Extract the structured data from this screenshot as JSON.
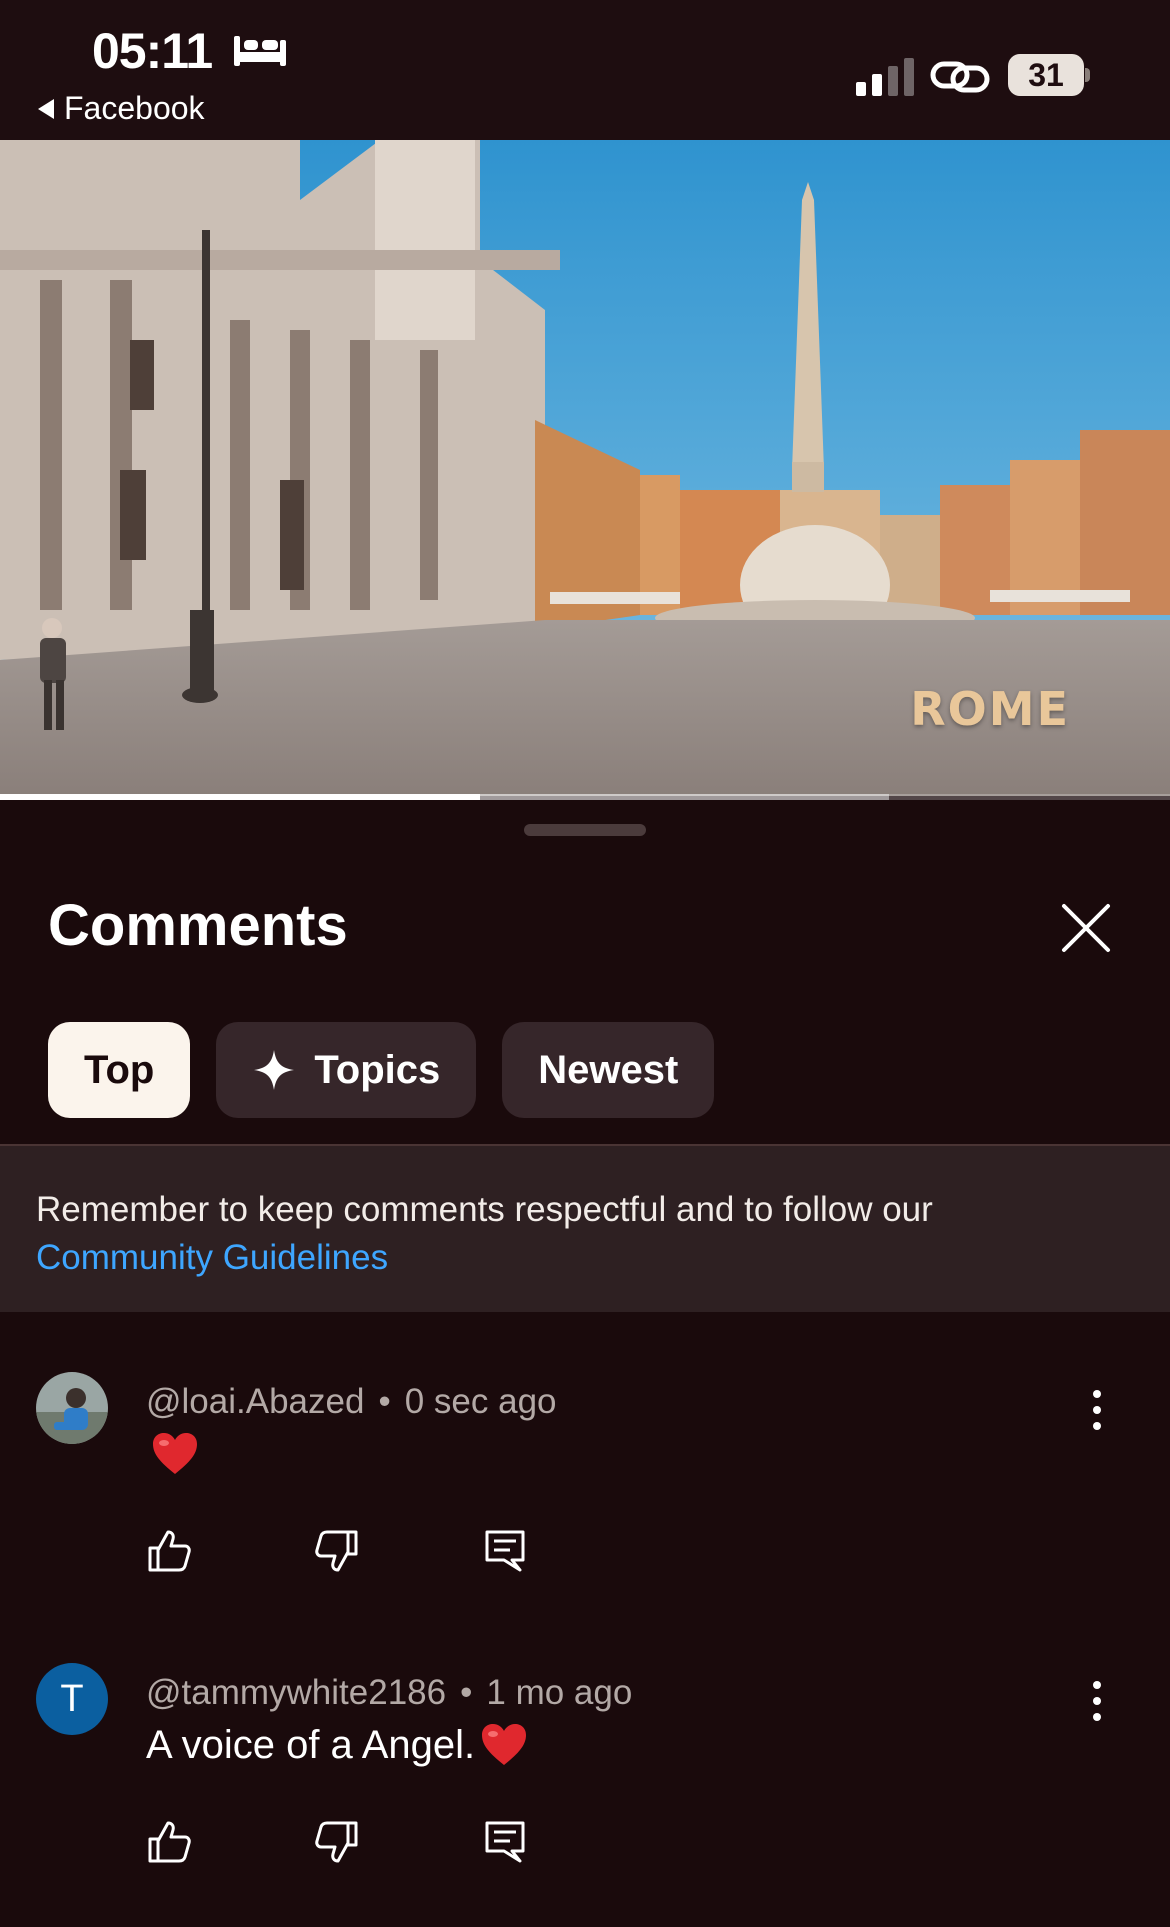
{
  "status_bar": {
    "time": "05:11",
    "back_app": "Facebook",
    "battery": "31"
  },
  "video": {
    "caption": "ROME",
    "progress": 0.41,
    "buffered": 0.76
  },
  "comments_sheet": {
    "title": "Comments",
    "tabs": [
      {
        "label": "Top",
        "active": true
      },
      {
        "label": "Topics",
        "active": false,
        "icon": "sparkle-icon"
      },
      {
        "label": "Newest",
        "active": false
      }
    ],
    "notice": {
      "text": "Remember to keep comments respectful and to follow our",
      "link": "Community Guidelines"
    },
    "comments": [
      {
        "author": "@loai.Abazed",
        "time": "0 sec ago",
        "text": "",
        "emoji": "heart",
        "avatar": "photo"
      },
      {
        "author": "@tammywhite2186",
        "time": "1 mo ago",
        "text": "A voice of a Angel.",
        "emoji": "heart",
        "avatar": "T"
      }
    ]
  },
  "colors": {
    "background": "#1a0a0c",
    "link": "#3ea6ff",
    "chip_active": "#fbf4ec",
    "chip_inactive": "#36262a",
    "avatar_t": "#0b5fa0",
    "heart": "#e0282e"
  }
}
